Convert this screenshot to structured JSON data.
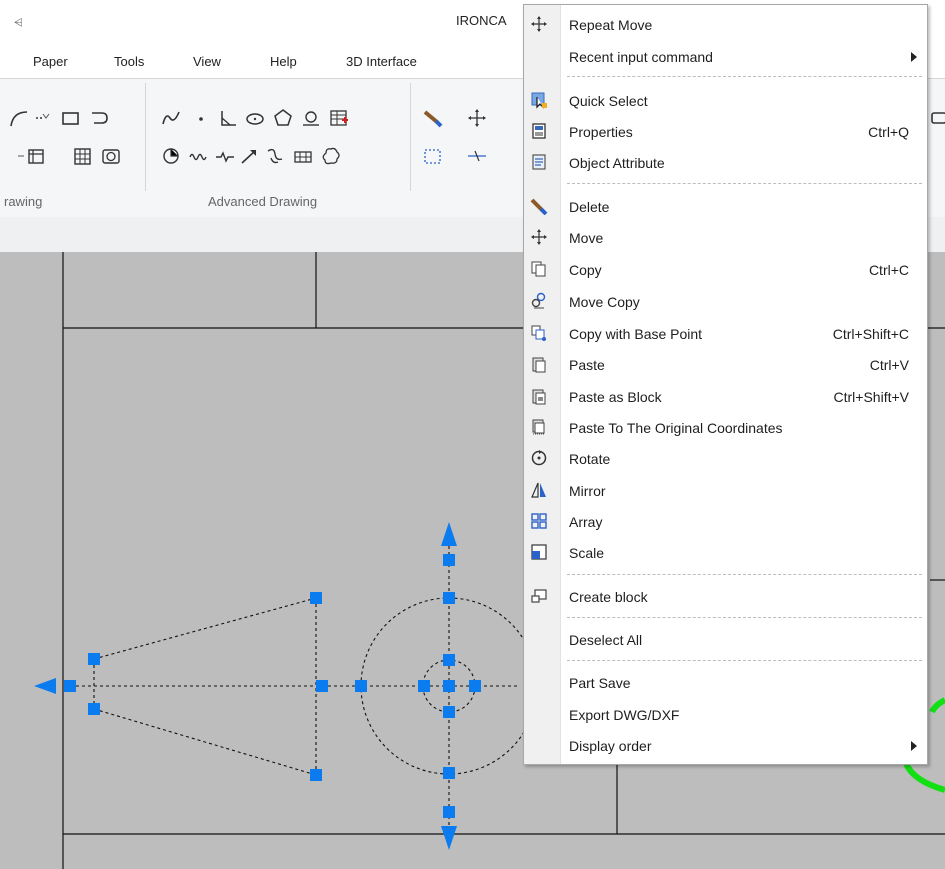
{
  "titlebar": {
    "quick_access": "⩤",
    "title": "IRONCA"
  },
  "menubar": {
    "items": [
      "Paper",
      "Tools",
      "View",
      "Help",
      "3D Interface"
    ]
  },
  "ribbon": {
    "groups": [
      {
        "label": "rawing"
      },
      {
        "label": "Advanced Drawing"
      }
    ],
    "icons": [
      "arc-icon",
      "polyline-icon",
      "rectangle-icon",
      "spline-icon",
      "point-icon",
      "angle-icon",
      "ellipse-icon",
      "polygon-icon",
      "revcloud-icon",
      "table-icon",
      "brush-icon",
      "move-icon",
      "hatch-icon",
      "wave-icon",
      "break-icon",
      "arrow-icon",
      "region-icon",
      "grid-icon",
      "cloud-icon",
      "dashed-rect-icon",
      "dimension-icon"
    ]
  },
  "context_menu": {
    "items": [
      {
        "icon": "move-icon",
        "label": "Repeat Move",
        "shortcut": ""
      },
      {
        "icon": "",
        "label": "Recent input command",
        "shortcut": "",
        "submenu": true
      },
      {
        "icon": "quick-select-icon",
        "label": "Quick Select",
        "shortcut": ""
      },
      {
        "icon": "properties-icon",
        "label": "Properties",
        "shortcut": "Ctrl+Q"
      },
      {
        "icon": "object-attribute-icon",
        "label": "Object Attribute",
        "shortcut": ""
      },
      {
        "icon": "delete-icon",
        "label": "Delete",
        "shortcut": ""
      },
      {
        "icon": "move-icon",
        "label": "Move",
        "shortcut": ""
      },
      {
        "icon": "copy-icon",
        "label": "Copy",
        "shortcut": "Ctrl+C"
      },
      {
        "icon": "move-copy-icon",
        "label": "Move Copy",
        "shortcut": ""
      },
      {
        "icon": "copy-base-point-icon",
        "label": "Copy with Base Point",
        "shortcut": "Ctrl+Shift+C"
      },
      {
        "icon": "paste-icon",
        "label": "Paste",
        "shortcut": "Ctrl+V"
      },
      {
        "icon": "paste-block-icon",
        "label": "Paste as Block",
        "shortcut": "Ctrl+Shift+V"
      },
      {
        "icon": "paste-original-icon",
        "label": "Paste To The Original Coordinates",
        "shortcut": ""
      },
      {
        "icon": "rotate-icon",
        "label": "Rotate",
        "shortcut": ""
      },
      {
        "icon": "mirror-icon",
        "label": "Mirror",
        "shortcut": ""
      },
      {
        "icon": "array-icon",
        "label": "Array",
        "shortcut": ""
      },
      {
        "icon": "scale-icon",
        "label": "Scale",
        "shortcut": ""
      },
      {
        "icon": "create-block-icon",
        "label": "Create block",
        "shortcut": ""
      },
      {
        "icon": "",
        "label": "Deselect All",
        "shortcut": ""
      },
      {
        "icon": "",
        "label": "Part Save",
        "shortcut": ""
      },
      {
        "icon": "",
        "label": "Export DWG/DXF",
        "shortcut": ""
      },
      {
        "icon": "",
        "label": "Display order",
        "shortcut": "",
        "submenu": true
      }
    ]
  },
  "colors": {
    "grip": "#0a7cf0",
    "canvas": "#bdbdbd",
    "highlight_green": "#12e012"
  }
}
